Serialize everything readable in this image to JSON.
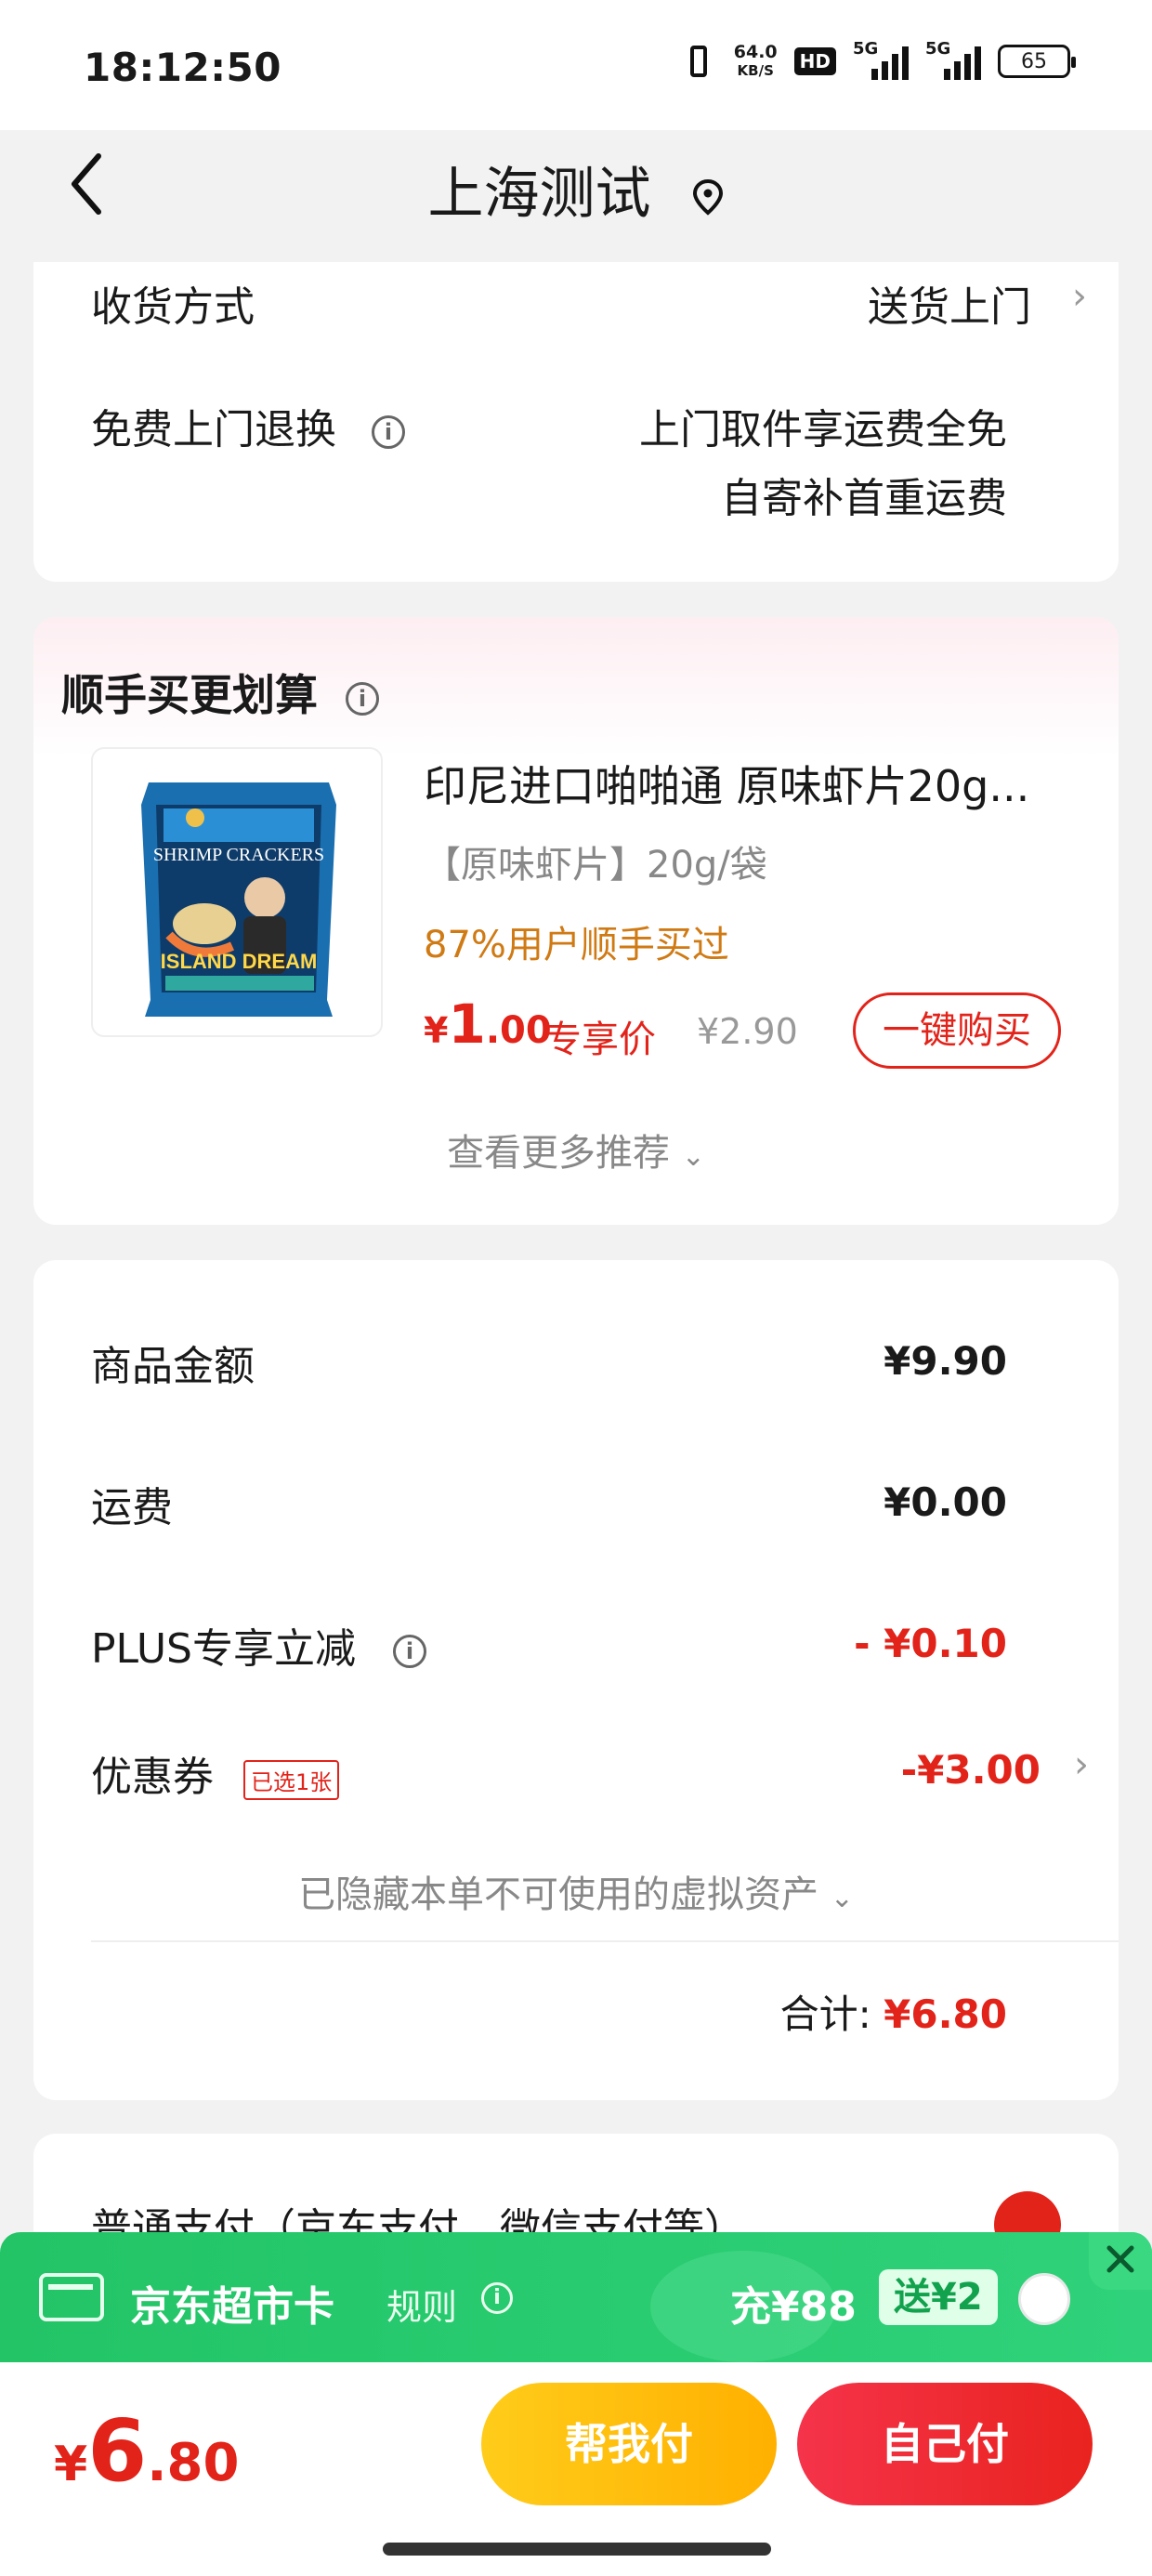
{
  "status_bar": {
    "time": "18:12:50",
    "net_speed_value": "64.0",
    "net_speed_unit": "KB/S",
    "hd_label": "HD",
    "sim1_label": "5G",
    "sim2_label": "5G",
    "battery": "65"
  },
  "nav": {
    "title": "上海测试",
    "back_icon": "chevron-left-icon",
    "location_icon": "location-pin-icon"
  },
  "delivery": {
    "method_label": "收货方式",
    "method_value": "送货上门",
    "return_label": "免费上门退换",
    "return_value_line1": "上门取件享运费全免",
    "return_value_line2": "自寄补首重运费"
  },
  "recommend": {
    "title": "顺手买更划算",
    "product": {
      "name": "印尼进口啪啪通 原味虾片20g...",
      "spec": "【原味虾片】20g/袋",
      "bought": "87%用户顺手买过",
      "price_symbol": "¥",
      "price_int": "1",
      "price_dec": ".00",
      "exclusive_label": "专享价",
      "original_price": "¥2.90",
      "buy_label": "一键购买",
      "image_text_top": "SHRIMP CRACKERS",
      "image_text_bottom": "ISLAND DREAM"
    },
    "more_label": "查看更多推荐"
  },
  "summary": {
    "goods_label": "商品金额",
    "goods_value": "¥9.90",
    "shipping_label": "运费",
    "shipping_value": "¥0.00",
    "plus_label": "PLUS专享立减",
    "plus_value": "- ¥0.10",
    "coupon_label": "优惠券",
    "coupon_tag": "已选1张",
    "coupon_value": "-¥3.00",
    "hidden_assets": "已隐藏本单不可使用的虚拟资产",
    "total_label": "合计:",
    "total_value": "¥6.80"
  },
  "payment": {
    "method_label": "普通支付（京东支付、微信支付等）"
  },
  "promo": {
    "title": "京东超市卡",
    "rule_label": "规则",
    "charge_label": "充¥88",
    "bonus_label": "送¥2"
  },
  "bottom": {
    "price_symbol": "¥",
    "price_int": "6",
    "price_dec": ".80",
    "help_pay_label": "帮我付",
    "self_pay_label": "自己付"
  },
  "colors": {
    "accent_red": "#e2231a",
    "promo_green": "#22c466",
    "help_yellow": "#ffb000",
    "bought_orange": "#d07a14"
  }
}
